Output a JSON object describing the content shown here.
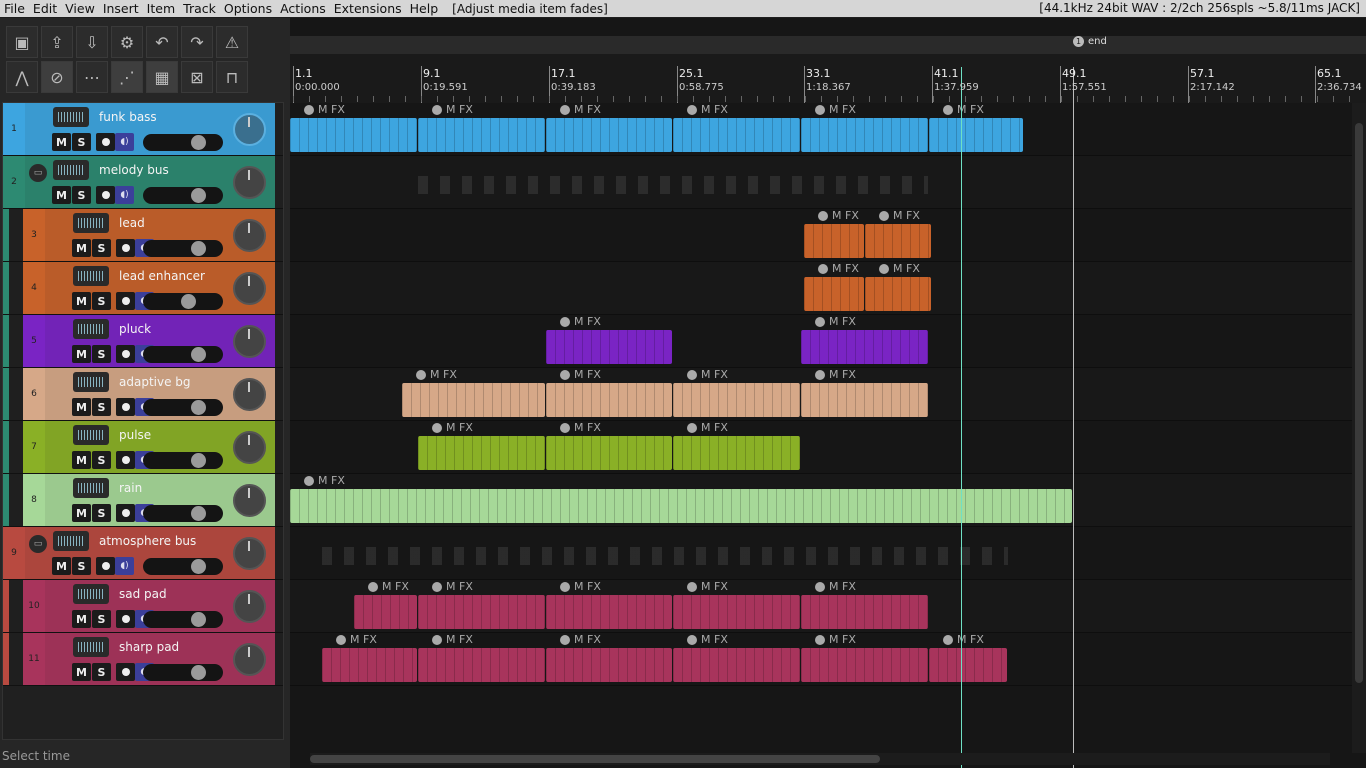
{
  "menu": {
    "items": [
      "File",
      "Edit",
      "View",
      "Insert",
      "Item",
      "Track",
      "Options",
      "Actions",
      "Extensions",
      "Help"
    ],
    "window_title": "[Adjust media item fades]",
    "status": "[44.1kHz 24bit WAV : 2/2ch 256spls ~5.8/11ms JACK]"
  },
  "toolbar": {
    "icons": [
      "project-icon",
      "new-project-icon",
      "save-icon",
      "settings-icon",
      "undo-icon",
      "redo-icon",
      "metronome-icon",
      "crossfade-icon",
      "link-icon",
      "grid-icon",
      "envelope-icon",
      "snap-grid-icon",
      "ripple-icon",
      "lock-icon"
    ]
  },
  "tracks": [
    {
      "num": "1",
      "name": "funk bass",
      "color": "#3da5e0"
    },
    {
      "num": "2",
      "name": "melody bus",
      "color": "#2d8a72",
      "folder": true
    },
    {
      "num": "3",
      "name": "lead",
      "color": "#c8622a"
    },
    {
      "num": "4",
      "name": "lead enhancer",
      "color": "#c8622a"
    },
    {
      "num": "5",
      "name": "pluck",
      "color": "#7a24c4"
    },
    {
      "num": "6",
      "name": "adaptive bg",
      "color": "#d6a888"
    },
    {
      "num": "7",
      "name": "pulse",
      "color": "#8ab026"
    },
    {
      "num": "8",
      "name": "rain",
      "color": "#a6d898"
    },
    {
      "num": "9",
      "name": "atmosphere bus",
      "color": "#b84a40",
      "folder": true
    },
    {
      "num": "10",
      "name": "sad pad",
      "color": "#a8345c"
    },
    {
      "num": "11",
      "name": "sharp pad",
      "color": "#a8345c"
    }
  ],
  "track_buttons": {
    "mute": "M",
    "solo": "S",
    "mon": "◖)"
  },
  "ruler": [
    {
      "bar": "1.1",
      "time": "0:00.000"
    },
    {
      "bar": "9.1",
      "time": "0:19.591"
    },
    {
      "bar": "17.1",
      "time": "0:39.183"
    },
    {
      "bar": "25.1",
      "time": "0:58.775"
    },
    {
      "bar": "33.1",
      "time": "1:18.367"
    },
    {
      "bar": "41.1",
      "time": "1:37.959"
    },
    {
      "bar": "49.1",
      "time": "1:57.551"
    },
    {
      "bar": "57.1",
      "time": "2:17.142"
    },
    {
      "bar": "65.1",
      "time": "2:36.734"
    }
  ],
  "end_marker": {
    "num": "1",
    "label": "end"
  },
  "item_label": "M FX",
  "status_line": "Select time",
  "colors": {
    "cursor": "#6fe0c4",
    "bg": "#161616"
  }
}
